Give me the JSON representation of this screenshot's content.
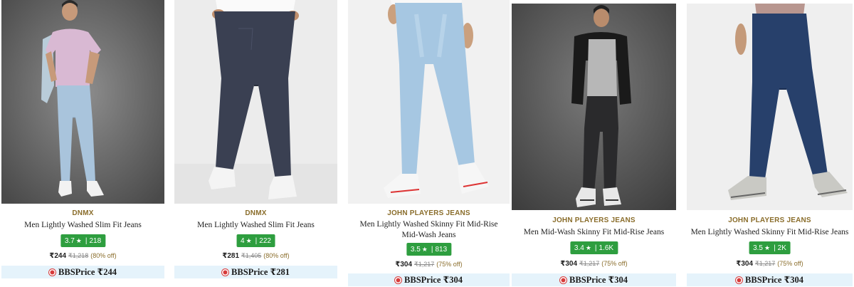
{
  "currency_symbol": "₹",
  "colors": {
    "brand_text": "#8a6d2b",
    "rating_badge": "#2e9e3f",
    "bbs_bar": "#e5f3fb",
    "bbs_logo": "#d63b3b"
  },
  "products": [
    {
      "brand": "DNMX",
      "title": "Men Lightly Washed Slim Fit Jeans",
      "rating": "3.7",
      "reviews": "218",
      "price": "₹244",
      "mrp": "₹1,218",
      "discount": "(80% off)",
      "bbs_label": "BBSPrice ₹244",
      "image": "model wearing light blue slim jeans and pink t-shirt"
    },
    {
      "brand": "DNMX",
      "title": "Men Lightly Washed Slim Fit Jeans",
      "rating": "4",
      "reviews": "222",
      "price": "₹281",
      "mrp": "₹1,405",
      "discount": "(80% off)",
      "bbs_label": "BBSPrice ₹281",
      "image": "dark navy acid wash jeans with white sneakers"
    },
    {
      "brand": "JOHN PLAYERS JEANS",
      "title": "Men Lightly Washed Skinny Fit Mid-Rise Mid-Wash Jeans",
      "rating": "3.5",
      "reviews": "813",
      "price": "₹304",
      "mrp": "₹1,217",
      "discount": "(75% off)",
      "bbs_label": "BBSPrice ₹304",
      "image": "light blue skinny jeans with white sneakers"
    },
    {
      "brand": "JOHN PLAYERS JEANS",
      "title": "Men Mid-Wash Skinny Fit Mid-Rise Jeans",
      "rating": "3.4",
      "reviews": "1.6K",
      "price": "₹304",
      "mrp": "₹1,217",
      "discount": "(75% off)",
      "bbs_label": "BBSPrice ₹304",
      "image": "model in black jacket, grey tee and black jeans"
    },
    {
      "brand": "JOHN PLAYERS JEANS",
      "title": "Men Lightly Washed Skinny Fit Mid-Rise Jeans",
      "rating": "3.5",
      "reviews": "2K",
      "price": "₹304",
      "mrp": "₹1,217",
      "discount": "(75% off)",
      "bbs_label": "BBSPrice ₹304",
      "image": "dark blue skinny jeans with grey sneakers"
    }
  ]
}
